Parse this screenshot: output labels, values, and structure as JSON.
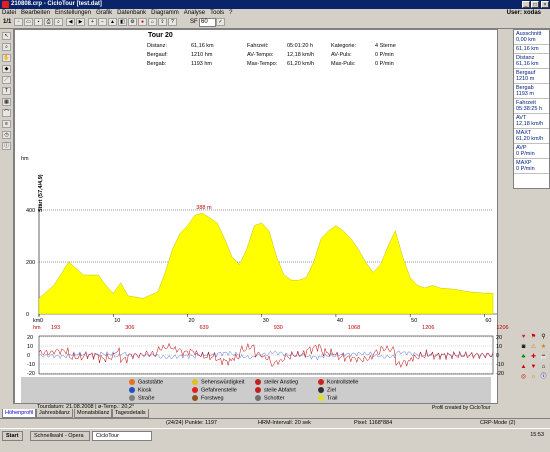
{
  "window": {
    "title": "210808.crp - CicloTour [test.dat]",
    "user_label": "User: xodas"
  },
  "menu": [
    "Datei",
    "Bearbeiten",
    "Einstellungen",
    "Grafik",
    "Datenbank",
    "Diagramm",
    "Analyse",
    "Tools",
    "?"
  ],
  "toolbar": {
    "page_label": "1/1",
    "sf_label": "SF",
    "sf_value": "60"
  },
  "tour": {
    "title": "Tour 20",
    "rows": [
      [
        "Distanz:",
        "61,16 km",
        "Fahrzeit:",
        "05:01:20 h",
        "Kategorie:",
        "4 Sterne"
      ],
      [
        "Bergauf:",
        "1210 hm",
        "AV-Tempo:",
        "12,18 km/h",
        "AV-Puls:",
        "0 P/min"
      ],
      [
        "Bergab:",
        "1193 hm",
        "Max-Tempo:",
        "61,20 km/h",
        "Max-Puls:",
        "0 P/min"
      ]
    ]
  },
  "right_stats": [
    {
      "label": "Ausschnitt",
      "value": "0,00 km"
    },
    {
      "label": "",
      "value": "61,16 km"
    },
    {
      "label": "Distanz",
      "value": "61,16 km"
    },
    {
      "label": "Bergauf",
      "value": "1210 m"
    },
    {
      "label": "Bergab",
      "value": "1193 m"
    },
    {
      "label": "Fahrzeit",
      "value": "05:38:25 h"
    },
    {
      "label": "AVT",
      "value": "12,18 km/h"
    },
    {
      "label": "MAXT",
      "value": "61,20 km/h"
    },
    {
      "label": "AVP",
      "value": "0 P/min"
    },
    {
      "label": "MAXP",
      "value": "0 P/min"
    }
  ],
  "chart_data": {
    "type": "area",
    "ylabel": "hm",
    "xlabel": "km",
    "start_label": "Start (57,4/4,9)",
    "peak_label": "388 m",
    "ylim": [
      0,
      400
    ],
    "xlim": [
      0,
      61.16
    ],
    "y_ticks": [
      "400",
      "200",
      "0"
    ],
    "x_ticks": [
      "0",
      "10",
      "20",
      "30",
      "40",
      "50",
      "60"
    ],
    "hm_label": "hm",
    "hm_values": [
      "193",
      "306",
      "639",
      "930",
      "1068",
      "1206",
      "1206"
    ],
    "x": [
      0,
      2,
      4,
      6,
      8,
      9,
      10,
      11,
      12,
      14,
      16,
      17,
      18,
      19,
      20,
      21,
      22,
      23,
      24,
      25,
      26,
      27,
      28,
      29,
      30,
      31,
      32,
      33,
      34,
      35,
      36,
      37,
      38,
      39,
      40,
      41,
      42,
      43,
      44,
      45,
      46,
      47,
      48,
      49,
      50,
      51,
      52,
      53,
      54,
      56,
      58,
      60,
      61.16
    ],
    "y": [
      60,
      110,
      200,
      150,
      150,
      110,
      80,
      120,
      70,
      60,
      85,
      160,
      250,
      310,
      340,
      380,
      388,
      370,
      350,
      290,
      220,
      190,
      250,
      340,
      350,
      320,
      220,
      150,
      130,
      130,
      140,
      200,
      290,
      320,
      340,
      320,
      290,
      250,
      200,
      160,
      190,
      260,
      320,
      220,
      140,
      110,
      100,
      110,
      100,
      95,
      85,
      80,
      80
    ],
    "lower_y_ticks": [
      "20",
      "10",
      "0",
      "-10",
      "-20"
    ]
  },
  "legend": [
    {
      "label": "Gaststätte",
      "color": "#e87020"
    },
    {
      "label": "Kiosk",
      "color": "#2050c0"
    },
    {
      "label": "Straße",
      "color": "#808080"
    },
    {
      "label": "Sehenswürdigkeit",
      "color": "#e0c020"
    },
    {
      "label": "Gefahrenstelle",
      "color": "#e02020"
    },
    {
      "label": "Forstweg",
      "color": "#905020"
    },
    {
      "label": "steiler Anstieg",
      "color": "#c02020"
    },
    {
      "label": "steile Abfahrt",
      "color": "#c02020"
    },
    {
      "label": "Schotter",
      "color": "#707070"
    },
    {
      "label": "Kontrollstelle",
      "color": "#d02020"
    },
    {
      "label": "Ziel",
      "color": "#303030"
    },
    {
      "label": "Trail",
      "color": "#e0e020"
    }
  ],
  "footer": {
    "tourdatum": "Tourdatum: 21.08.2008 | ø-Temp.: 20,2°",
    "profil": "Profil created by CicloTour"
  },
  "tabs": [
    "Höhenprofil",
    "Jahresbilanz",
    "Monatsbilanz",
    "Tagesdetails"
  ],
  "status": {
    "points": "(24/24) Punkte: 1197",
    "interval": "HRM-Intervall: 20 sek",
    "pixel": "Pixel: 1168*884",
    "mode": "CRP-Mode (2)"
  },
  "taskbar": {
    "start": "Start",
    "items": [
      "Schnellwahl - Opera",
      "CicloTour"
    ],
    "clock": "15:53"
  }
}
